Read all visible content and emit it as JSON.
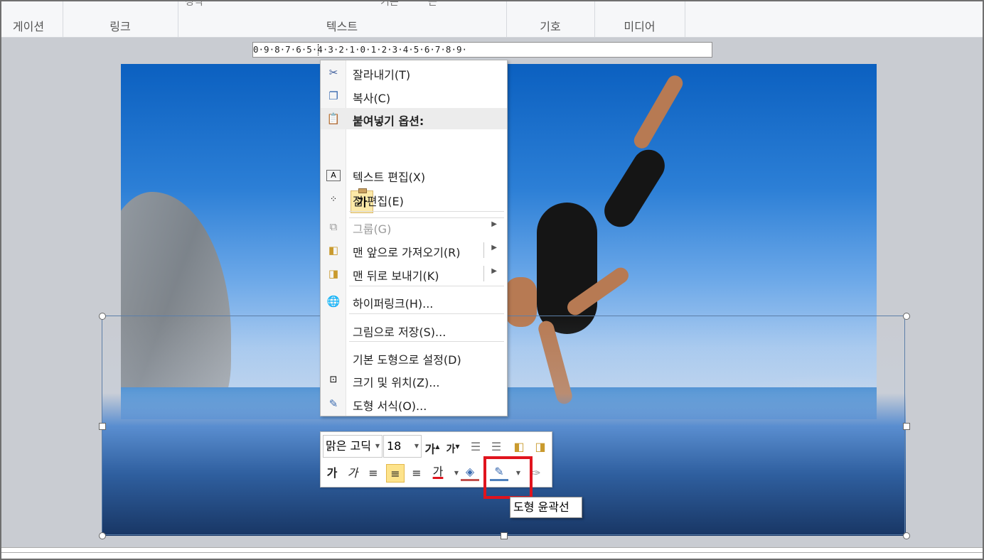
{
  "ribbon": {
    "top_partial_1": "정식",
    "top_partial_2": "기본",
    "top_partial_3": "는",
    "groups": [
      {
        "label": "게이션"
      },
      {
        "label": "링크"
      },
      {
        "label": "텍스트"
      },
      {
        "label": "기호"
      },
      {
        "label": "미디어"
      }
    ]
  },
  "ruler": {
    "text": "0·9·8·7·6·5·4·3·2·1·0·1·2·3·4·5·6·7·8·9·"
  },
  "context_menu": {
    "cut": {
      "label": "잘라내기(T)",
      "icon": "scissors-icon"
    },
    "copy": {
      "label": "복사(C)",
      "icon": "copy-icon"
    },
    "paste_options": {
      "label": "붙여넣기 옵션:",
      "icon": "clipboard-icon"
    },
    "paste_text_only": {
      "label": "가"
    },
    "edit_text": {
      "label": "텍스트 편집(X)",
      "icon": "text-box-icon"
    },
    "edit_points": {
      "label": "점 편집(E)",
      "icon": "edit-points-icon"
    },
    "group": {
      "label": "그룹(G)",
      "icon": "group-icon",
      "disabled": true
    },
    "bring_front": {
      "label": "맨 앞으로 가져오기(R)",
      "icon": "bring-front-icon"
    },
    "send_back": {
      "label": "맨 뒤로 보내기(K)",
      "icon": "send-back-icon"
    },
    "hyperlink": {
      "label": "하이퍼링크(H)...",
      "icon": "globe-link-icon"
    },
    "save_picture": {
      "label": "그림으로 저장(S)..."
    },
    "set_default": {
      "label": "기본 도형으로 설정(D)"
    },
    "size_position": {
      "label": "크기 및 위치(Z)...",
      "icon": "size-position-icon"
    },
    "format_shape": {
      "label": "도형 서식(O)...",
      "icon": "format-shape-icon"
    }
  },
  "mini_toolbar": {
    "font_name": "맑은 고딕",
    "font_size": "18",
    "grow_font": "가",
    "shrink_font": "가",
    "bold": "가",
    "italic": "가",
    "font_color": "가",
    "font_color_swatch": "#e0141e",
    "fill_swatch": "#c0504d",
    "outline_swatch": "#4f81bd"
  },
  "tooltip": {
    "text": "도형 윤곽선"
  },
  "colors": {
    "highlight": "#e0141e",
    "active_button": "#fde38b"
  }
}
